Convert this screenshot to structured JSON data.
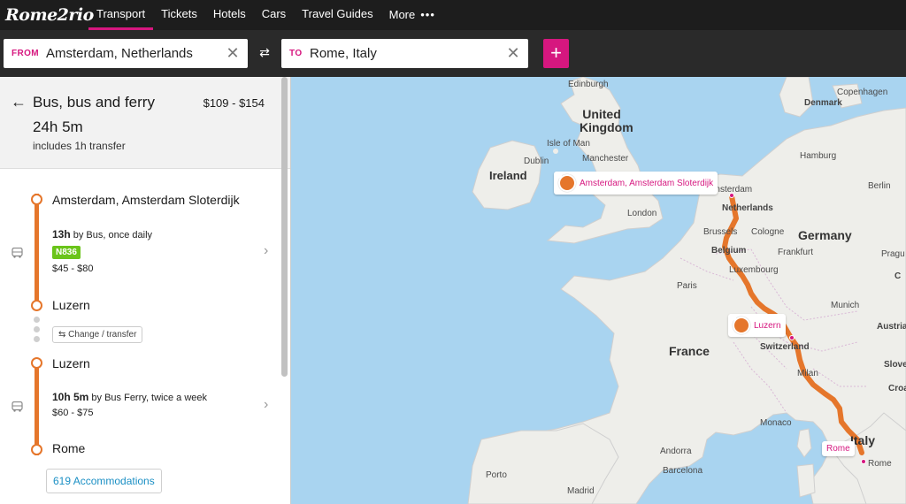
{
  "nav": {
    "logo": "Rome2rio",
    "items": [
      "Transport",
      "Tickets",
      "Hotels",
      "Cars",
      "Travel Guides"
    ],
    "more": "More",
    "active": "Transport"
  },
  "search": {
    "from_tag": "FROM",
    "from_value": "Amsterdam, Netherlands",
    "to_tag": "TO",
    "to_value": "Rome, Italy",
    "clear_glyph": "✕",
    "swap_glyph": "⇄",
    "add_glyph": "+"
  },
  "route": {
    "title": "Bus, bus and ferry",
    "price": "$109 - $154",
    "duration": "24h 5m",
    "transfer_note": "includes 1h transfer"
  },
  "legs": [
    {
      "from": "Amsterdam, Amsterdam Sloterdijk",
      "duration": "13h",
      "mode": " by Bus, once daily",
      "badge": "N836",
      "price": "$45 - $80",
      "to": "Luzern"
    },
    {
      "from": "Luzern",
      "duration": "10h 5m",
      "mode": " by Bus Ferry, twice a week",
      "price": "$60 - $75",
      "to": "Rome"
    }
  ],
  "change_label": "Change / transfer",
  "accommodations": "619 Accommodations",
  "map": {
    "cities": [
      "Edinburgh",
      "Isle of Man",
      "Manchester",
      "Dublin",
      "London",
      "Amsterdam",
      "Brussels",
      "Cologne",
      "Frankfurt",
      "Paris",
      "Luxembourg",
      "Munich",
      "Milan",
      "Monaco",
      "Andorra",
      "Barcelona",
      "Porto",
      "Madrid",
      "Copenhagen",
      "Hamburg",
      "Berlin",
      "Prague",
      "Rome"
    ],
    "countries": [
      "United Kingdom",
      "Ireland",
      "Netherlands",
      "Belgium",
      "Germany",
      "France",
      "Switzerland",
      "Italy",
      "Denmark",
      "Austria",
      "Slovenia",
      "Croatia"
    ],
    "countries_cut": [
      "Pragu",
      "Austria",
      "Slove",
      "Croa",
      "C"
    ],
    "labels": [
      "Amsterdam, Amsterdam Sloterdijk",
      "Luzern",
      "Rome"
    ],
    "route_color": "#e5762b",
    "accent": "#d6177f"
  }
}
